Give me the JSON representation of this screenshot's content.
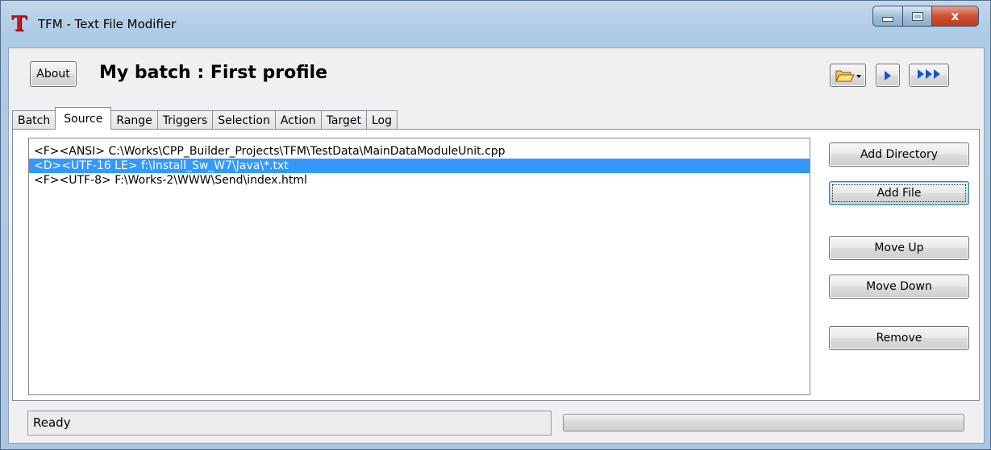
{
  "window": {
    "title": "TFM - Text File Modifier",
    "app_icon": "T",
    "close_glyph": "x"
  },
  "toolbar": {
    "about_label": "About",
    "heading": "My batch : First profile"
  },
  "tabs": [
    {
      "label": "Batch"
    },
    {
      "label": "Source",
      "active": true
    },
    {
      "label": "Range"
    },
    {
      "label": "Triggers"
    },
    {
      "label": "Selection"
    },
    {
      "label": "Action"
    },
    {
      "label": "Target"
    },
    {
      "label": "Log"
    }
  ],
  "source_list": {
    "items": [
      {
        "text": "<F><ANSI> C:\\Works\\CPP_Builder_Projects\\TFM\\TestData\\MainDataModuleUnit.cpp",
        "selected": false
      },
      {
        "text": "<D><UTF-16 LE> f:\\Install_Sw_W7\\Java\\*.txt",
        "selected": true
      },
      {
        "text": "<F><UTF-8> F:\\Works-2\\WWW\\Send\\index.html",
        "selected": false
      }
    ]
  },
  "buttons": {
    "add_directory": "Add Directory",
    "add_file": "Add File",
    "move_up": "Move Up",
    "move_down": "Move Down",
    "remove": "Remove"
  },
  "status": {
    "text": "Ready",
    "progress": 0
  },
  "colors": {
    "selection": "#3399ff",
    "run_arrow": "#1a55c8",
    "close_button": "#c13a1e"
  },
  "icons": [
    "app-logo-icon",
    "folder-open-icon",
    "dropdown-arrow-icon",
    "run-icon",
    "run-all-icon",
    "minimize-icon",
    "maximize-icon",
    "close-icon"
  ]
}
